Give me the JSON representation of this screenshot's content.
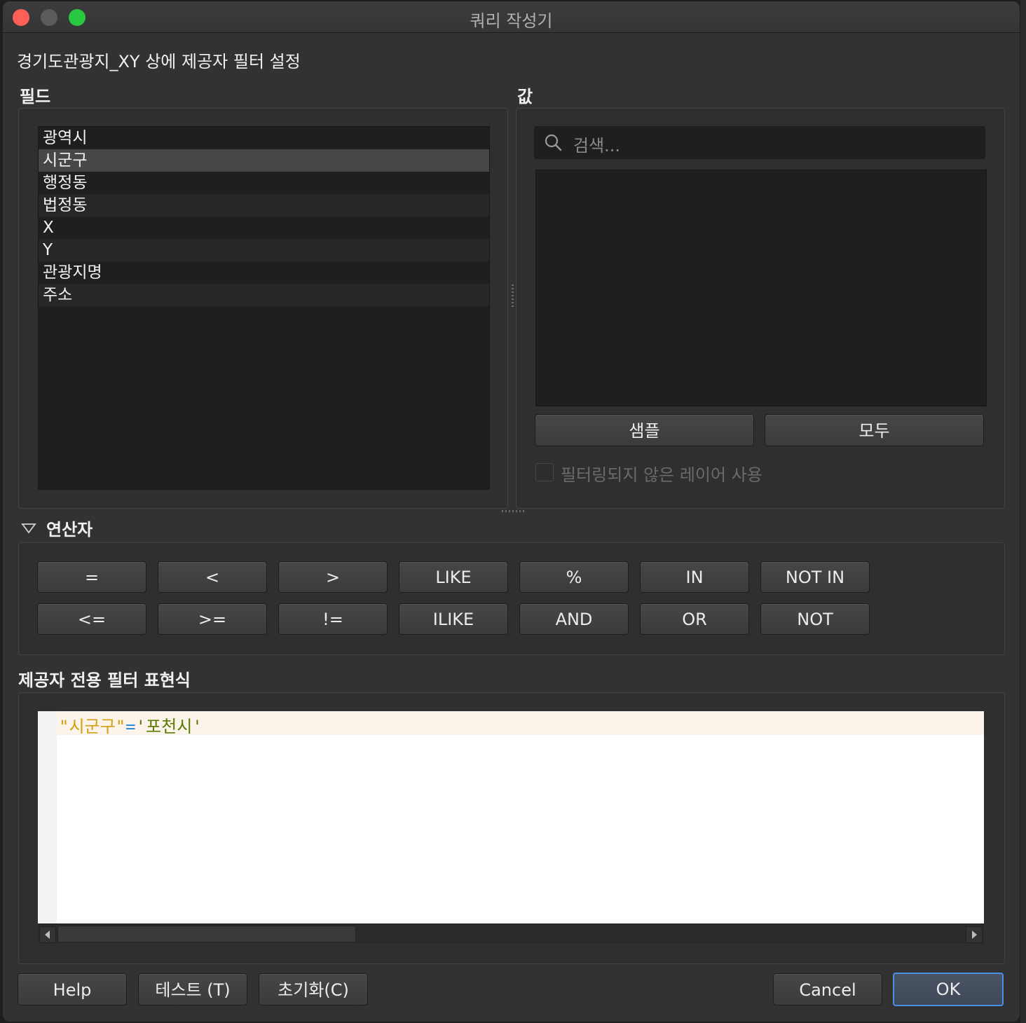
{
  "window": {
    "title": "쿼리 작성기"
  },
  "dialog": {
    "subtitle": "경기도관광지_XY 상에 제공자 필터 설정"
  },
  "fields": {
    "heading": "필드",
    "items": [
      "광역시",
      "시군구",
      "행정동",
      "법정동",
      "X",
      "Y",
      "관광지명",
      "주소"
    ],
    "selected": "시군구"
  },
  "values": {
    "heading": "값",
    "search_placeholder": "검색...",
    "sample_label": "샘플",
    "all_label": "모두",
    "unfiltered_checkbox_label": "필터링되지 않은 레이어 사용",
    "unfiltered_checked": false
  },
  "operators": {
    "heading": "연산자",
    "row1": [
      "=",
      "<",
      ">",
      "LIKE",
      "%",
      "IN",
      "NOT IN"
    ],
    "row2": [
      "<=",
      ">=",
      "!=",
      "ILIKE",
      "AND",
      "OR",
      "NOT"
    ]
  },
  "expression": {
    "heading": "제공자 전용 필터 표현식",
    "field_token": "\"시군구\"",
    "operator_token": "=",
    "value_token": "'포천시'",
    "colors": {
      "field": "#d4a012",
      "operator": "#2b8bd8",
      "value": "#5a7a00"
    }
  },
  "buttons": {
    "help": "Help",
    "test": "테스트 (T)",
    "reset": "초기화(C)",
    "cancel": "Cancel",
    "ok": "OK"
  },
  "icons": {
    "search": "search-icon",
    "collapse": "triangle-down-icon",
    "scroll_left": "arrow-left-icon",
    "scroll_right": "arrow-right-icon"
  }
}
